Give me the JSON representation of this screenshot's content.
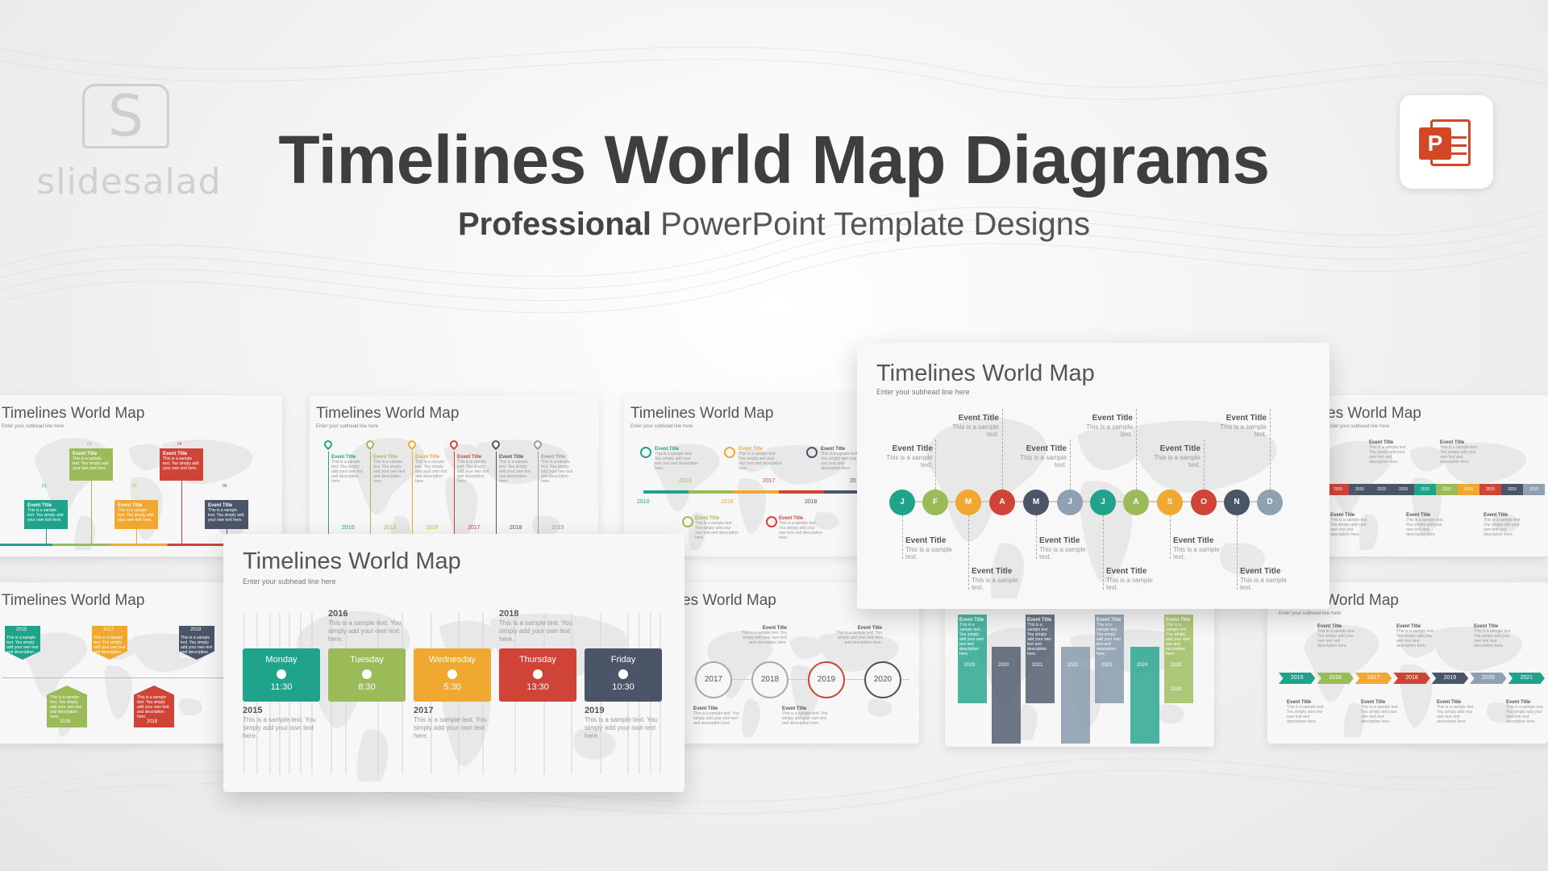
{
  "header": {
    "brand": "slidesalad",
    "brand_icon": "S",
    "title": "Timelines World Map Diagrams",
    "subtitle_bold": "Professional",
    "subtitle_rest": "PowerPoint Template Designs",
    "ppt_icon": "powerpoint-icon",
    "ppt_letter": "P"
  },
  "thumb_slides": [
    {
      "title": "Timelines World Map",
      "sub": "Enter your subhead line here"
    },
    {
      "title": "Timelines World Map",
      "sub": "Enter your subhead line here"
    },
    {
      "title": "Timelines World Map",
      "sub": "Enter your subhead line here"
    },
    {
      "title": "es World Map",
      "sub": "Enter your subhead line here"
    },
    {
      "title": "Timelines World Map",
      "sub": ""
    },
    {
      "title": "es World Map",
      "sub": ""
    },
    {
      "title": "es World Map",
      "sub": "Enter your subhead line here"
    }
  ],
  "slide1": {
    "steps": [
      "01",
      "02",
      "03",
      "04",
      "05"
    ],
    "event_title": "Event Title",
    "text": "This is a sample text. You simply add your own text here."
  },
  "slide2": {
    "event_title": "Event Title",
    "text": "This is a sample text. You simply add your own text and description here.",
    "years": [
      "2010",
      "2013",
      "2016",
      "2017",
      "2018",
      "2019"
    ]
  },
  "slide3": {
    "event_title": "Event Title",
    "text": "This is a sample text. You simply add your own text and description here.",
    "years_bottom": [
      "2010",
      "2016",
      "2018"
    ],
    "years_top": [
      "2013",
      "2017"
    ],
    "year_edge": "20"
  },
  "slide5": {
    "years_top": [
      "2015",
      "2017",
      "2019"
    ],
    "years_bottom": [
      "2016",
      "2018"
    ],
    "text": "This is a sample text. You simply add your own text and description here."
  },
  "slide6": {
    "years": [
      "2017",
      "2018",
      "2019",
      "2020"
    ],
    "event_title": "Event Title",
    "text": "This is a sample text. You simply add your own text and description here."
  },
  "slide7": {
    "years": [
      "2019",
      "2020",
      "2021",
      "2022",
      "2023",
      "2024",
      "2025",
      "2026"
    ],
    "event_title": "Event Title",
    "text": "This is a sample text. You simply add your own text and description here."
  },
  "slide8": {
    "years": [
      "2015",
      "2016",
      "2017",
      "2018",
      "2019",
      "2020",
      "2021"
    ],
    "event_title": "Event Title",
    "text": "This is a sample text. You simply add your own text and description here."
  },
  "slide4": {
    "years": [
      "2015",
      "2015",
      "2015",
      "2015",
      "2015",
      "2015",
      "2015",
      "2015",
      "2015",
      "2015"
    ],
    "event_title": "Event Title",
    "text": "This is a sample text. You simply add your own text and description here."
  },
  "big_left": {
    "title": "Timelines World Map",
    "sub": "Enter your subhead line here",
    "days": [
      {
        "name": "Monday",
        "time": "11:30"
      },
      {
        "name": "Tuesday",
        "time": "8:30"
      },
      {
        "name": "Wednesday",
        "time": "5:30"
      },
      {
        "name": "Thursday",
        "time": "13:30"
      },
      {
        "name": "Friday",
        "time": "10:30"
      }
    ],
    "top_years": [
      {
        "year": "2016",
        "text": "This is a sample text. You simply add your own text here."
      },
      {
        "year": "2018",
        "text": "This is a sample text. You simply add your own text here."
      }
    ],
    "bottom_years": [
      {
        "year": "2015",
        "text": "This is a sample text. You simply add your own text here."
      },
      {
        "year": "2017",
        "text": "This is a sample text. You simply add your own text here."
      },
      {
        "year": "2019",
        "text": "This is a sample text. You simply add your own text here."
      }
    ]
  },
  "big_right": {
    "title": "Timelines World Map",
    "sub": "Enter your subhead line here",
    "months": [
      "J",
      "F",
      "M",
      "A",
      "M",
      "J",
      "J",
      "A",
      "S",
      "O",
      "N",
      "D"
    ],
    "event_title": "Event Title",
    "event_text": "This is a sample text."
  },
  "colors": {
    "teal": "#1fa38a",
    "green": "#9bbb59",
    "orange": "#f0a830",
    "red": "#d04437",
    "slate": "#4a5568",
    "grey": "#8fa0b0",
    "ppt": "#d24726"
  }
}
